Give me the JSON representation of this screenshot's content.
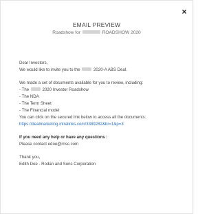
{
  "modal": {
    "close_label": "×",
    "title": "EMAIL PREVIEW",
    "subtitle_before": "Roadshow for",
    "subtitle_after": "ROADSHOW 2020"
  },
  "email": {
    "greeting": "Dear Investors,",
    "invite_before": "We would like to invite you to the",
    "invite_after": "2020-A ABS Deal.",
    "intro": "We made a set of documents available for you to review, including:",
    "doc1_before": "- The",
    "doc1_after": "2020 Investor Roadshow",
    "doc2": "- The NDA",
    "doc3": "- The Term Sheet",
    "doc4": "- The Financial model",
    "access_text": "You can click on the secured link below to access all the documents:",
    "link": "https://dealmarketing.intralinks.com/3389282&br=1&p=3",
    "help_heading": "If you need any help or have any questions :",
    "contact": "Please contact edoe@rnsc.com",
    "thanks": "Thank you,",
    "signature": "Edith Doe - Rodan and Sons Corporation"
  }
}
